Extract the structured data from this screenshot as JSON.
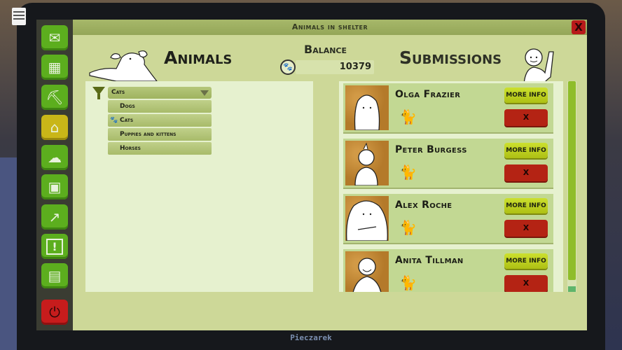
{
  "taskbar": {
    "icon": "task-list-icon"
  },
  "window": {
    "title": "Animals in shelter",
    "close_label": "X"
  },
  "sidebar": {
    "items": [
      {
        "name": "mail",
        "icon": "envelope-icon",
        "glyph": "✉",
        "active": false
      },
      {
        "name": "shop",
        "icon": "basket-icon",
        "glyph": "🧺",
        "active": false
      },
      {
        "name": "cleaning",
        "icon": "shovel-icon",
        "glyph": "⛏",
        "active": false
      },
      {
        "name": "animals-in-shelter",
        "icon": "animal-house-icon",
        "glyph": "⌂",
        "active": true
      },
      {
        "name": "sick-animals",
        "icon": "rain-cloud-cat-icon",
        "glyph": "☁",
        "active": false
      },
      {
        "name": "animal-photo",
        "icon": "dog-photo-icon",
        "glyph": "▣",
        "active": false
      },
      {
        "name": "statistics",
        "icon": "trend-arrow-icon",
        "glyph": "↗",
        "active": false
      },
      {
        "name": "alerts",
        "icon": "exclamation-icon",
        "glyph": "!",
        "active": false
      },
      {
        "name": "notebook",
        "icon": "notebook-icon",
        "glyph": "▤",
        "active": false
      },
      {
        "name": "power",
        "icon": "power-icon",
        "glyph": "⏻",
        "active": false
      }
    ]
  },
  "animals": {
    "title": "Animals",
    "filter": {
      "icon": "filter-icon",
      "selected": "Cats",
      "options": [
        {
          "label": "Dogs",
          "selected": false
        },
        {
          "label": "Cats",
          "selected": true
        },
        {
          "label": "Puppies and kittens",
          "selected": false
        },
        {
          "label": "Horses",
          "selected": false
        }
      ]
    }
  },
  "balance": {
    "label": "Balance",
    "value": "10379",
    "icon": "paw-coin-icon"
  },
  "submissions": {
    "title": "Submissions",
    "more_info_label": "MORE INFO",
    "reject_label": "X",
    "items": [
      {
        "name": "Olga Frazier",
        "animal_icon": "cat-icon"
      },
      {
        "name": "Peter Burgess",
        "animal_icon": "cat-icon"
      },
      {
        "name": "Alex Roche",
        "animal_icon": "cat-icon"
      },
      {
        "name": "Anita Tillman",
        "animal_icon": "cat-icon"
      }
    ],
    "scroll_visible_fraction": 0.97
  },
  "monitor": {
    "brand": "Pieczarek"
  }
}
